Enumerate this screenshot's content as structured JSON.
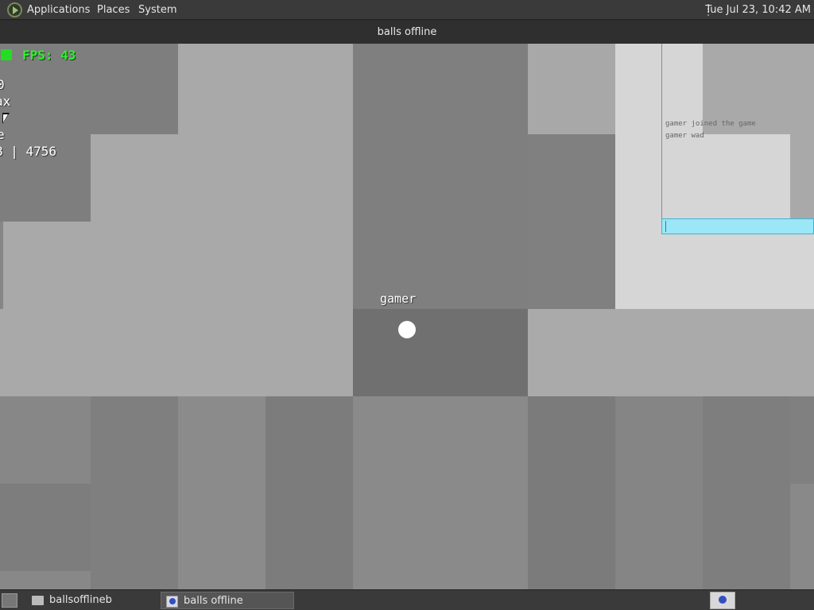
{
  "top_panel": {
    "menus": [
      "Applications",
      "Places",
      "System"
    ],
    "clock": "Tue Jul 23, 10:42 AM"
  },
  "window": {
    "title": "balls offline"
  },
  "hud": {
    "fps": "FPS: 43",
    "lines": [
      "0",
      "ax",
      "e",
      "8 | 4756"
    ]
  },
  "player": {
    "name": "gamer"
  },
  "chat": {
    "messages": [
      "gamer joined the game",
      "gamer wad"
    ],
    "input_value": ""
  },
  "taskbar": {
    "tasks": [
      "ballsofflineb",
      "balls offline"
    ]
  },
  "colors": {
    "fps_green": "#33ee33",
    "chat_input_bg": "#9be6f7",
    "ball": "#ffffff"
  },
  "icons": [
    "app-menu-logo-icon",
    "mouse-cursor-icon",
    "folder-icon",
    "game-icon",
    "show-desktop-icon"
  ]
}
